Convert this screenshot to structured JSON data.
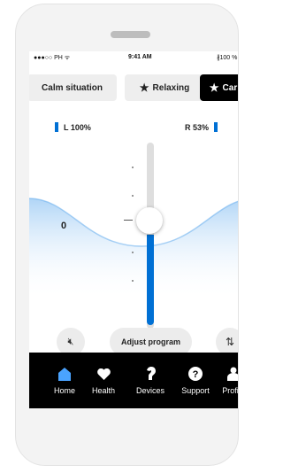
{
  "status": {
    "carrier": "●●●○○ PH ᯤ",
    "time": "9:41 AM",
    "battery": "∦100 %"
  },
  "programs": [
    {
      "label": "Calm situation",
      "active": false
    },
    {
      "label": "Relaxing",
      "active": false
    },
    {
      "label": "Car",
      "active": true
    }
  ],
  "volume": {
    "left_label": "L 100%",
    "right_label": "R 53%",
    "value_label": "0",
    "left_level": 1.0,
    "right_level": 0.53
  },
  "controls": {
    "adjust_label": "Adjust program"
  },
  "nav": [
    {
      "label": "Home",
      "icon": "home-icon",
      "active": true
    },
    {
      "label": "Health",
      "icon": "heart-icon",
      "active": false
    },
    {
      "label": "Devices",
      "icon": "hearing-aid-icon",
      "active": false
    },
    {
      "label": "Support",
      "icon": "question-icon",
      "active": false
    },
    {
      "label": "Profile",
      "icon": "person-icon",
      "active": false
    }
  ],
  "colors": {
    "accent": "#0070d4",
    "active_tab": "#000000",
    "nav_bg": "#000000"
  }
}
